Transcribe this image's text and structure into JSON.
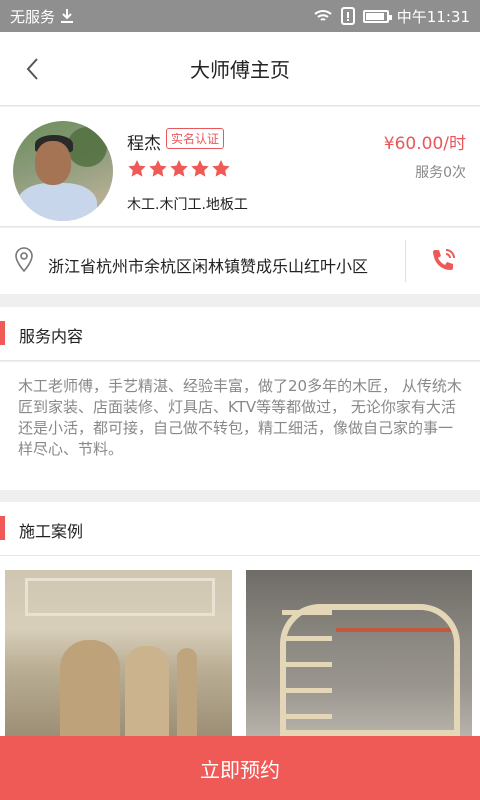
{
  "status_bar": {
    "carrier": "无服务",
    "time": "中午11:31"
  },
  "header": {
    "title": "大师傅主页"
  },
  "profile": {
    "name": "程杰",
    "badge": "实名认证",
    "rating": 5,
    "skills": "木工.木门工.地板工",
    "price": "¥60.00/时",
    "served": "服务0次"
  },
  "address": {
    "text": "浙江省杭州市余杭区闲林镇赞成乐山红叶小区"
  },
  "service_section": {
    "label": "服务内容",
    "content": "木工老师傅，手艺精湛、经验丰富，做了20多年的木匠， 从传统木匠到家装、店面装修、灯具店、KTV等等都做过， 无论你家有大活还是小活，都可接，自己做不转包，精工细活，像做自己家的事一样尽心、节料。"
  },
  "cases_section": {
    "label": "施工案例"
  },
  "actions": {
    "book_label": "立即预约"
  },
  "colors": {
    "accent": "#f05a56",
    "price": "#e8575a",
    "status_bar": "#8f8f8f"
  }
}
